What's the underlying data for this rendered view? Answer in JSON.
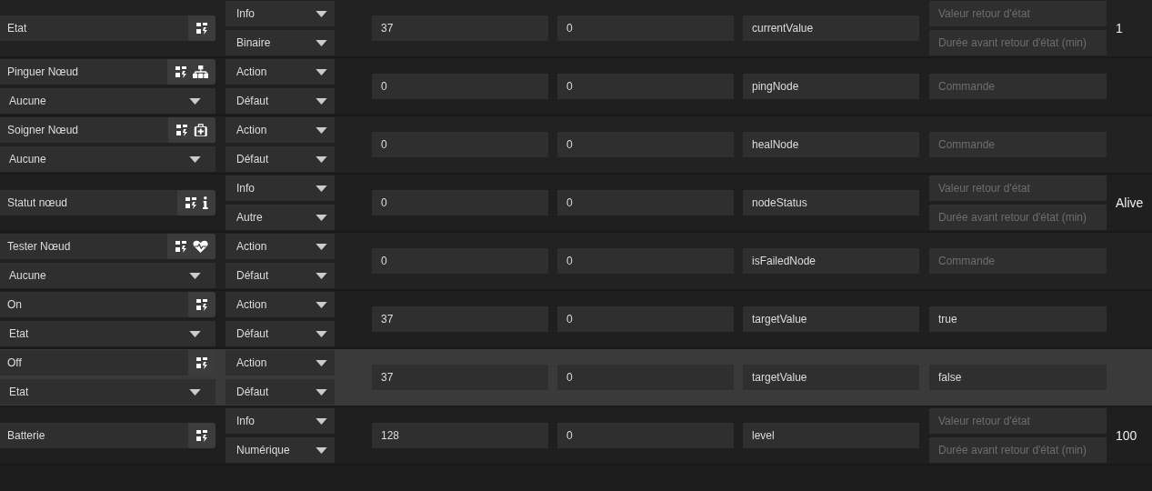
{
  "commands": [
    {
      "kind": "info",
      "name": "Etat",
      "icons": [
        {
          "kind": "device"
        }
      ],
      "type": "Info",
      "subtype": "Binaire",
      "value_1": "37",
      "value_2": "0",
      "logical_id": "currentValue",
      "return_fields": [
        {
          "placeholder": "Valeur retour d'état"
        },
        {
          "placeholder": "Durée avant retour d'état (min)"
        }
      ],
      "state": "1",
      "highlighted": false
    },
    {
      "kind": "action",
      "name": "Pinguer Nœud",
      "icons": [
        {
          "kind": "device"
        },
        {
          "kind": "sitemap"
        }
      ],
      "action_value": "Aucune",
      "type": "Action",
      "subtype": "Défaut",
      "value_1": "0",
      "value_2": "0",
      "logical_id": "pingNode",
      "command_field": {
        "placeholder": "Commande"
      },
      "highlighted": false
    },
    {
      "kind": "action",
      "name": "Soigner Nœud",
      "icons": [
        {
          "kind": "device"
        },
        {
          "kind": "medkit"
        }
      ],
      "action_value": "Aucune",
      "type": "Action",
      "subtype": "Défaut",
      "value_1": "0",
      "value_2": "0",
      "logical_id": "healNode",
      "command_field": {
        "placeholder": "Commande"
      },
      "highlighted": false
    },
    {
      "kind": "info",
      "name": "Statut nœud",
      "icons": [
        {
          "kind": "device"
        },
        {
          "kind": "info"
        }
      ],
      "type": "Info",
      "subtype": "Autre",
      "value_1": "0",
      "value_2": "0",
      "logical_id": "nodeStatus",
      "return_fields": [
        {
          "placeholder": "Valeur retour d'état"
        },
        {
          "placeholder": "Durée avant retour d'état (min)"
        }
      ],
      "state": "Alive",
      "highlighted": false
    },
    {
      "kind": "action",
      "name": "Tester Nœud",
      "icons": [
        {
          "kind": "device"
        },
        {
          "kind": "heartbeat"
        }
      ],
      "action_value": "Aucune",
      "type": "Action",
      "subtype": "Défaut",
      "value_1": "0",
      "value_2": "0",
      "logical_id": "isFailedNode",
      "command_field": {
        "placeholder": "Commande"
      },
      "highlighted": false
    },
    {
      "kind": "action",
      "name": "On",
      "icons": [
        {
          "kind": "device"
        }
      ],
      "action_value": "Etat",
      "type": "Action",
      "subtype": "Défaut",
      "value_1": "37",
      "value_2": "0",
      "logical_id": "targetValue",
      "command_field": {
        "value": "true"
      },
      "highlighted": false
    },
    {
      "kind": "action",
      "name": "Off",
      "icons": [
        {
          "kind": "device"
        }
      ],
      "action_value": "Etat",
      "type": "Action",
      "subtype": "Défaut",
      "value_1": "37",
      "value_2": "0",
      "logical_id": "targetValue",
      "command_field": {
        "value": "false"
      },
      "highlighted": true
    },
    {
      "kind": "info",
      "name": "Batterie",
      "icons": [
        {
          "kind": "device"
        }
      ],
      "type": "Info",
      "subtype": "Numérique",
      "value_1": "128",
      "value_2": "0",
      "logical_id": "level",
      "return_fields": [
        {
          "placeholder": "Valeur retour d'état"
        },
        {
          "placeholder": "Durée avant retour d'état (min)"
        }
      ],
      "state": "100",
      "highlighted": false
    }
  ]
}
